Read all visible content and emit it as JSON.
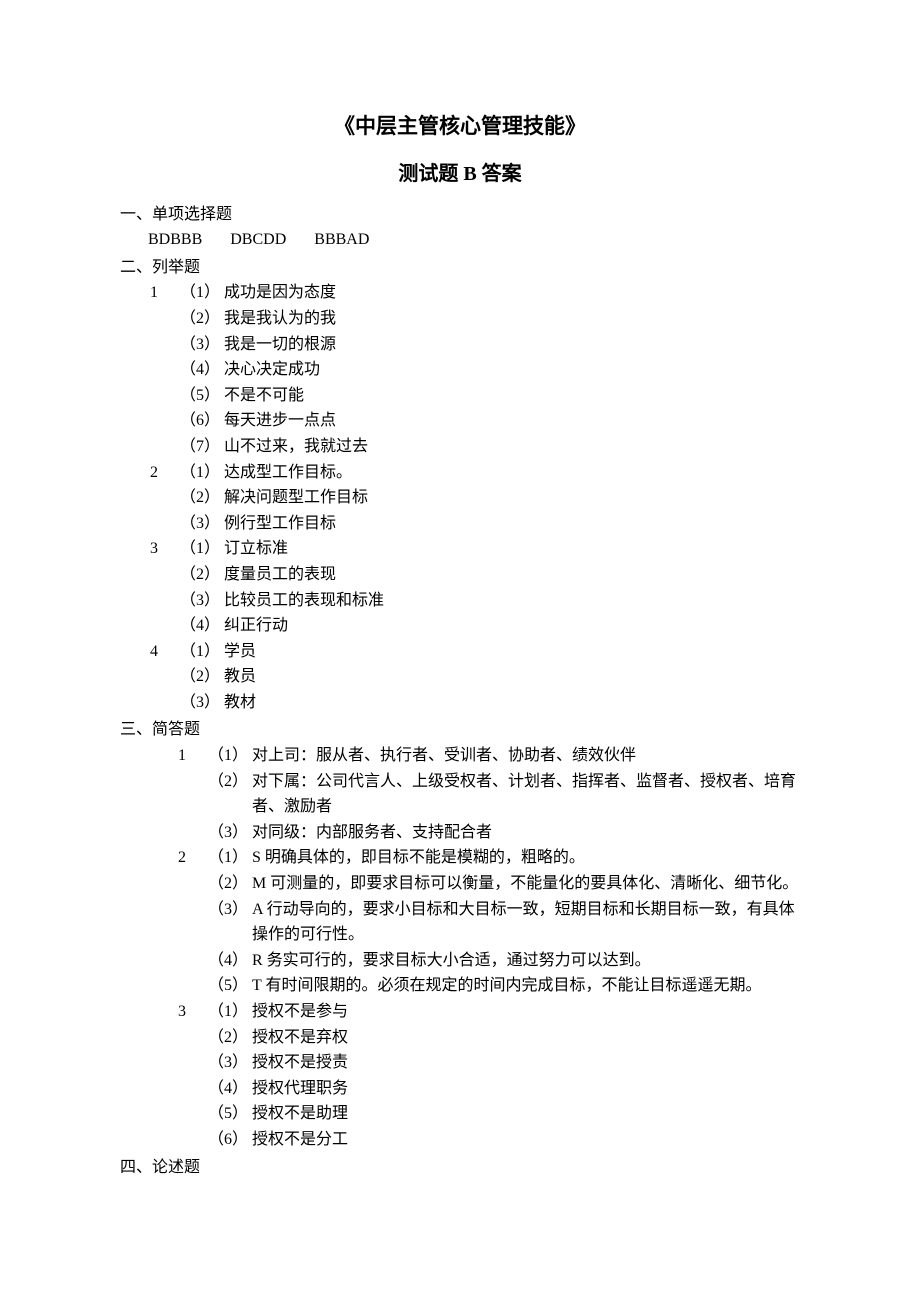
{
  "title": "《中层主管核心管理技能》",
  "subtitle": "测试题 B  答案",
  "sections": {
    "s1": {
      "heading": "一、单项选择题",
      "answers": [
        "BDBBB",
        "DBCDD",
        "BBBAD"
      ]
    },
    "s2": {
      "heading": "二、列举题",
      "q1": {
        "num": "1",
        "items": [
          {
            "m": "（1）",
            "t": "成功是因为态度"
          },
          {
            "m": "（2）",
            "t": "我是我认为的我"
          },
          {
            "m": "（3）",
            "t": "我是一切的根源"
          },
          {
            "m": "（4）",
            "t": "决心决定成功"
          },
          {
            "m": "（5）",
            "t": "不是不可能"
          },
          {
            "m": "（6）",
            "t": "每天进步一点点"
          },
          {
            "m": "（7）",
            "t": "山不过来，我就过去"
          }
        ]
      },
      "q2": {
        "num": "2",
        "items": [
          {
            "m": "（1）",
            "t": "达成型工作目标。"
          },
          {
            "m": "（2）",
            "t": "解决问题型工作目标"
          },
          {
            "m": "（3）",
            "t": "例行型工作目标"
          }
        ]
      },
      "q3": {
        "num": "3",
        "items": [
          {
            "m": "（1）",
            "t": "订立标准"
          },
          {
            "m": "（2）",
            "t": "度量员工的表现"
          },
          {
            "m": "（3）",
            "t": "比较员工的表现和标准"
          },
          {
            "m": "（4）",
            "t": "纠正行动"
          }
        ]
      },
      "q4": {
        "num": "4",
        "items": [
          {
            "m": "（1）",
            "t": "学员"
          },
          {
            "m": "（2）",
            "t": "教员"
          },
          {
            "m": "（3）",
            "t": "教材"
          }
        ]
      }
    },
    "s3": {
      "heading": "三、简答题",
      "q1": {
        "num": "1",
        "items": [
          {
            "m": "（1）",
            "t": "对上司：服从者、执行者、受训者、协助者、绩效伙伴"
          },
          {
            "m": "（2）",
            "t": "对下属：公司代言人、上级受权者、计划者、指挥者、监督者、授权者、培育者、激励者"
          },
          {
            "m": "（3）",
            "t": "对同级：内部服务者、支持配合者"
          }
        ]
      },
      "q2": {
        "num": "2",
        "items": [
          {
            "m": "（1）",
            "t": "S 明确具体的，即目标不能是模糊的，粗略的。"
          },
          {
            "m": "（2）",
            "t": "M 可测量的，即要求目标可以衡量，不能量化的要具体化、清晰化、细节化。"
          },
          {
            "m": "（3）",
            "t": "A 行动导向的，要求小目标和大目标一致，短期目标和长期目标一致，有具体操作的可行性。"
          },
          {
            "m": "（4）",
            "t": "R 务实可行的，要求目标大小合适，通过努力可以达到。"
          },
          {
            "m": "（5）",
            "t": "T 有时间限期的。必须在规定的时间内完成目标，不能让目标遥遥无期。"
          }
        ]
      },
      "q3": {
        "num": "3",
        "items": [
          {
            "m": "（1）",
            "t": "授权不是参与"
          },
          {
            "m": "（2）",
            "t": "授权不是弃权"
          },
          {
            "m": "（3）",
            "t": "授权不是授责"
          },
          {
            "m": "（4）",
            "t": "授权代理职务"
          },
          {
            "m": "（5）",
            "t": "授权不是助理"
          },
          {
            "m": "（6）",
            "t": "授权不是分工"
          }
        ]
      }
    },
    "s4": {
      "heading": "四、论述题"
    }
  }
}
